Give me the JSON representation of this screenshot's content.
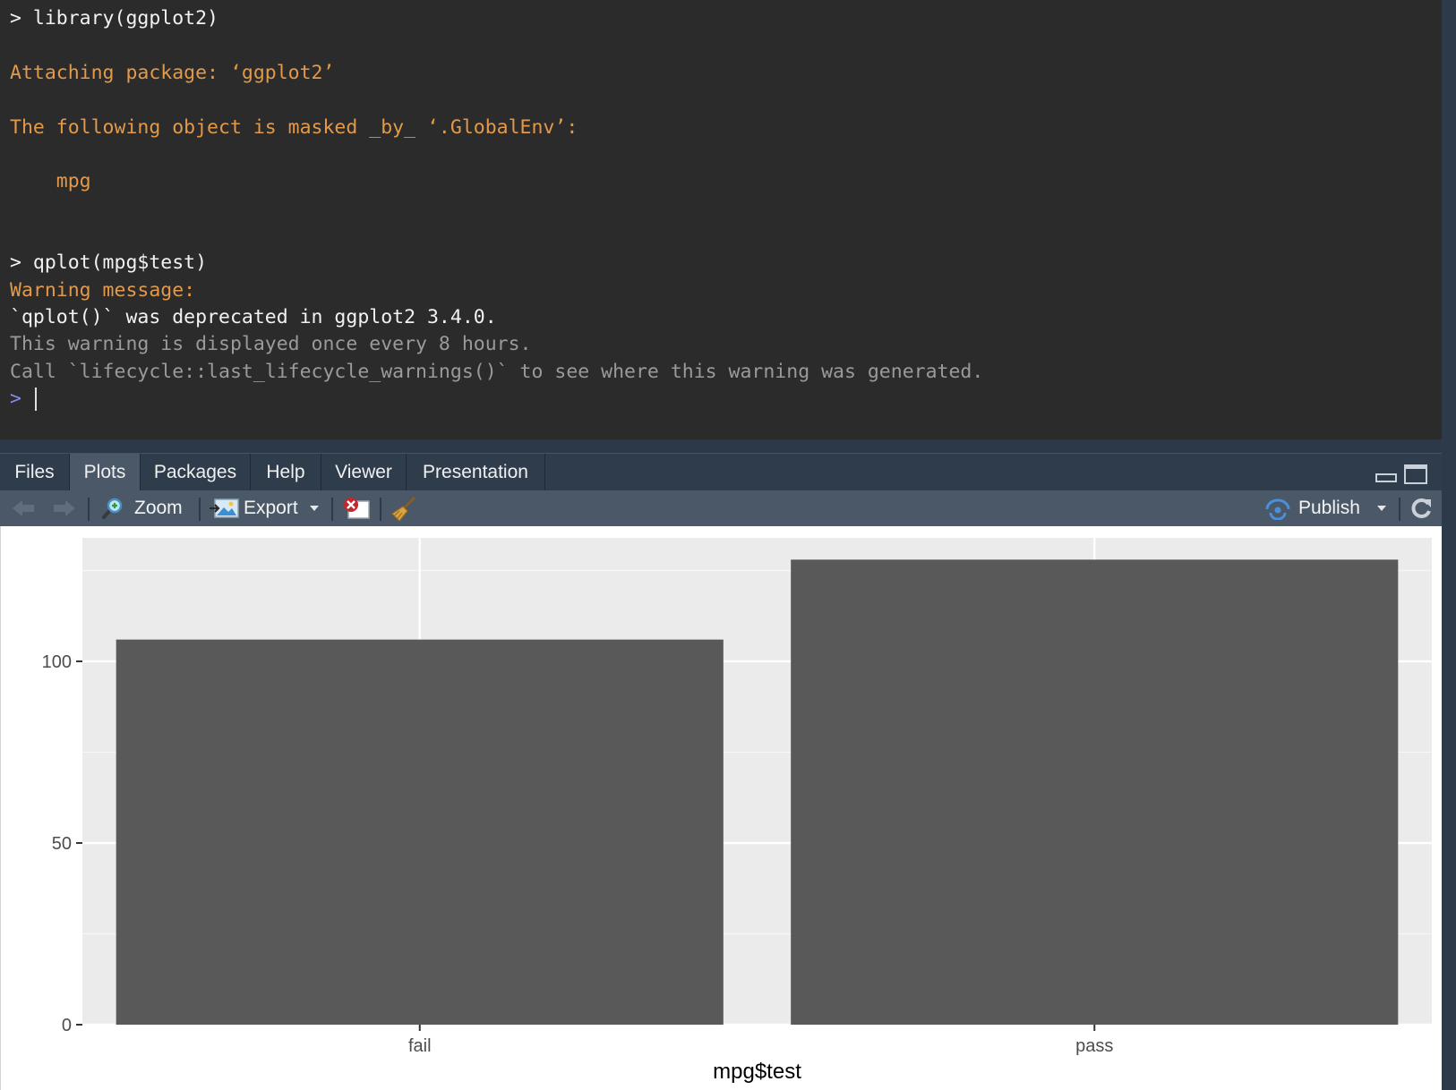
{
  "console": {
    "lines": [
      {
        "text": "> library(ggplot2)",
        "style": "white"
      },
      {
        "text": "Attaching package: ‘ggplot2’",
        "style": "orange"
      },
      {
        "text": "The following object is masked _by_ ‘.GlobalEnv’:",
        "style": "orange"
      },
      {
        "text": "    mpg",
        "style": "orange"
      },
      {
        "text": "> qplot(mpg$test)",
        "style": "white"
      },
      {
        "text": "Warning message:",
        "style": "orange"
      },
      {
        "text": "`qplot()` was deprecated in ggplot2 3.4.0.",
        "style": "white"
      },
      {
        "text": "This warning is displayed once every 8 hours.",
        "style": "gray"
      },
      {
        "text": "Call `lifecycle::last_lifecycle_warnings()` to see where this warning was generated.",
        "style": "gray"
      }
    ],
    "prompt": ">"
  },
  "tabs": [
    {
      "label": "Files"
    },
    {
      "label": "Plots"
    },
    {
      "label": "Packages"
    },
    {
      "label": "Help"
    },
    {
      "label": "Viewer"
    },
    {
      "label": "Presentation"
    }
  ],
  "active_tab": "Plots",
  "toolbar": {
    "zoom_label": "Zoom",
    "export_label": "Export",
    "publish_label": "Publish",
    "icons": [
      "back-arrow-icon",
      "forward-arrow-icon",
      "zoom-magnifier-icon",
      "export-image-icon",
      "remove-plot-icon",
      "broom-clear-icon",
      "publish-icon",
      "refresh-icon"
    ]
  },
  "colors": {
    "console_bg": "#2b2b2b",
    "console_orange": "#e3994a",
    "panel_bg": "#ebebeb",
    "bar_fill": "#595959",
    "publish_blue": "#4a90d9"
  },
  "chart_data": {
    "type": "bar",
    "categories": [
      "fail",
      "pass"
    ],
    "values": [
      106,
      128
    ],
    "xlabel": "mpg$test",
    "ylabel": "",
    "ylim": [
      0,
      134
    ],
    "yticks": [
      0,
      50,
      100
    ],
    "grid": true
  }
}
